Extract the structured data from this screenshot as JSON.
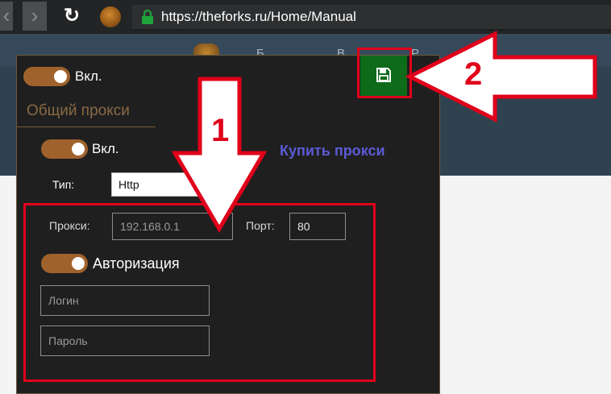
{
  "browser": {
    "url": "https://theforks.ru/Home/Manual",
    "back_glyph": "‹",
    "forward_glyph": "›",
    "reload_glyph": "↻"
  },
  "page": {
    "menu_ghost": [
      "Б",
      "В",
      "Р"
    ]
  },
  "panel": {
    "main_toggle": {
      "label": "Вкл.",
      "on": true
    },
    "section_title": "Общий прокси",
    "proxy_toggle": {
      "label": "Вкл.",
      "on": true
    },
    "buy_link": "Купить прокси",
    "type": {
      "label": "Тип:",
      "value": "Http"
    },
    "proxy": {
      "label": "Прокси:",
      "placeholder": "192.168.0.1"
    },
    "port": {
      "label": "Порт:",
      "value": "80"
    },
    "auth_toggle": {
      "label": "Авторизация",
      "on": true
    },
    "login": {
      "placeholder": "Логин"
    },
    "password": {
      "placeholder": "Пароль"
    }
  },
  "annotations": {
    "label_1": "1",
    "label_2": "2",
    "color": "#e0001a"
  },
  "colors": {
    "panel_bg": "#1f1f1f",
    "toggle_on": "#a0622c",
    "save_button": "#0d6b1a",
    "buy_link": "#5b5bd6"
  }
}
